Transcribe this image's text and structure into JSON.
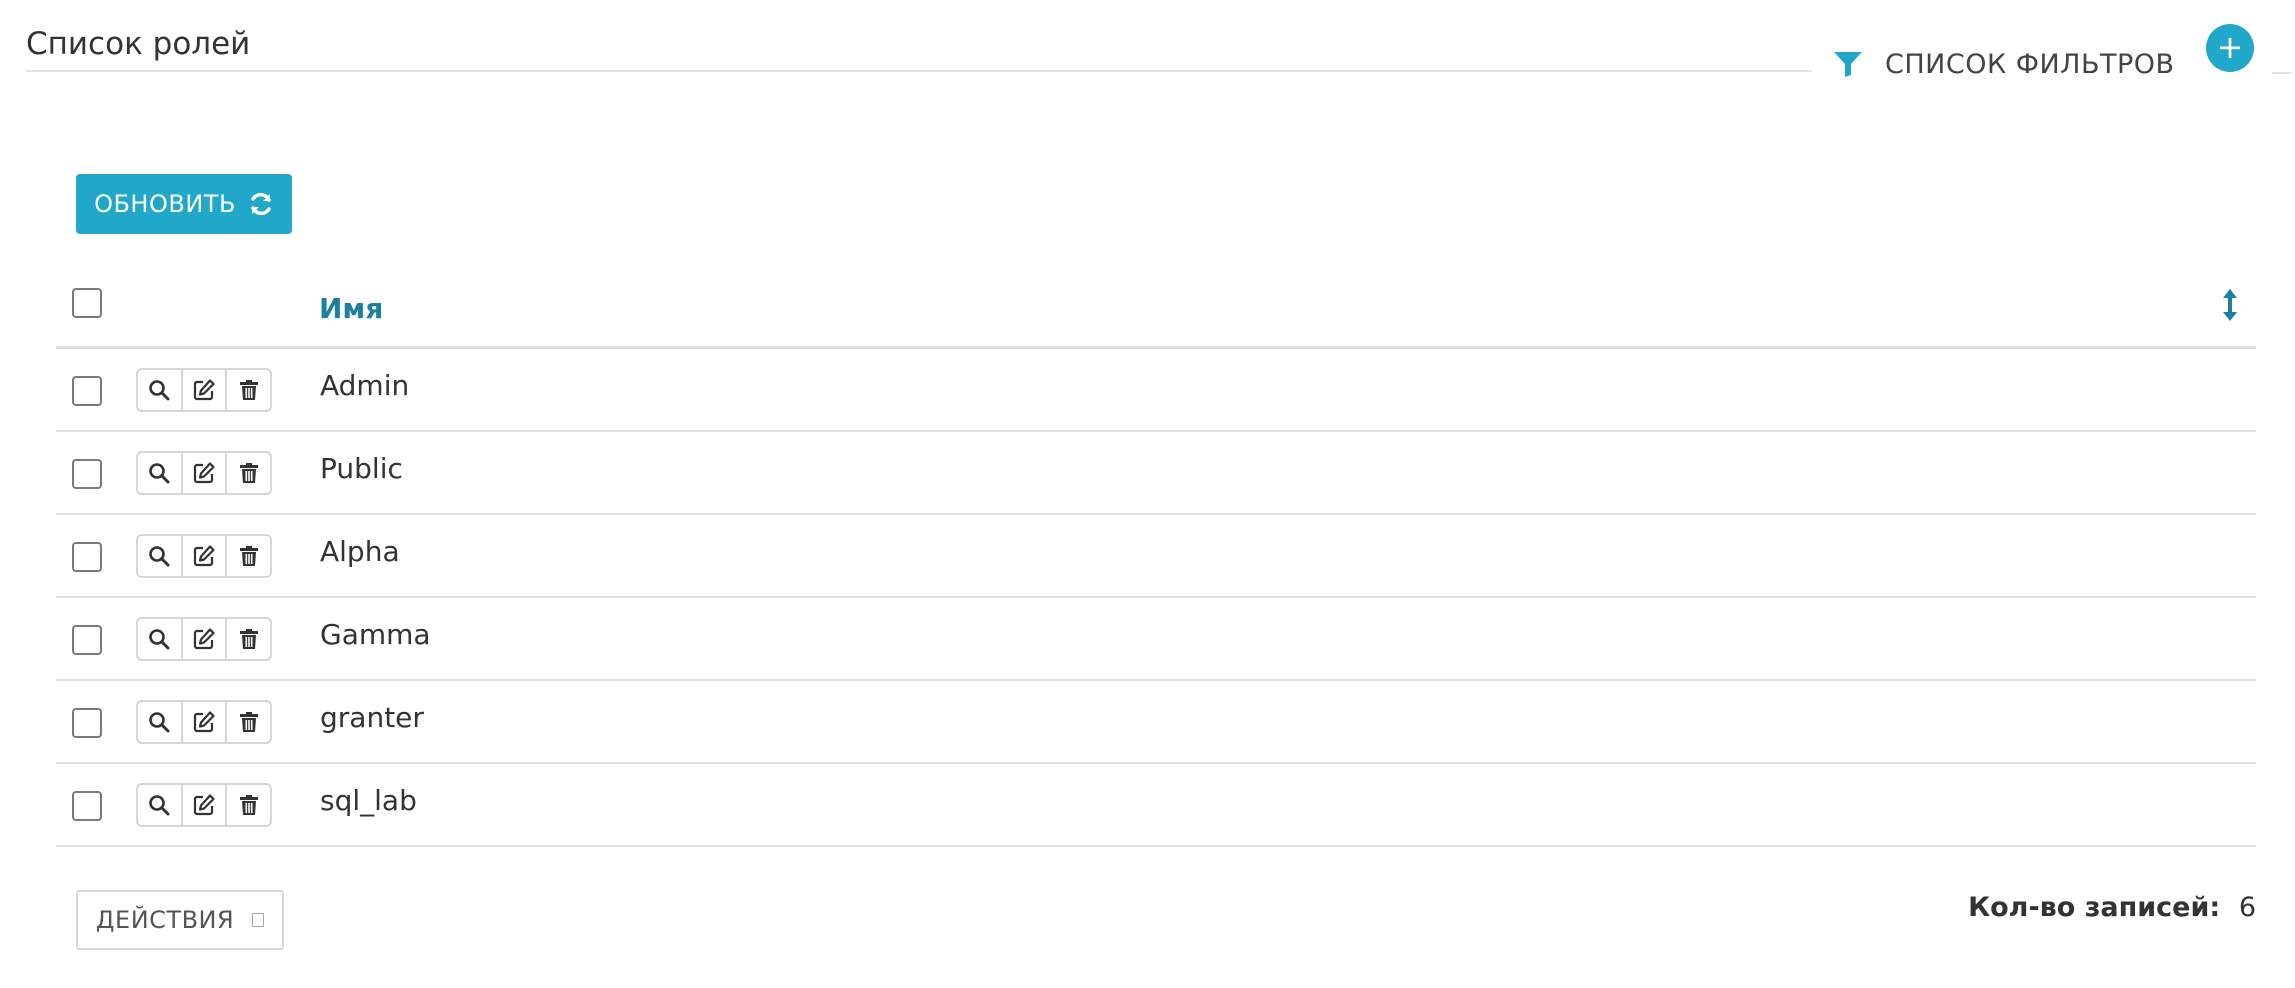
{
  "header": {
    "title": "Список ролей",
    "filter_label": "СПИСОК ФИЛЬТРОВ",
    "add_label": "+"
  },
  "toolbar": {
    "refresh_label": "ОБНОВИТЬ"
  },
  "table": {
    "columns": [
      "Имя"
    ],
    "rows": [
      {
        "name": "Admin"
      },
      {
        "name": "Public"
      },
      {
        "name": "Alpha"
      },
      {
        "name": "Gamma"
      },
      {
        "name": "granter"
      },
      {
        "name": "sql_lab"
      }
    ]
  },
  "footer": {
    "actions_label": "ДЕЙСТВИЯ",
    "record_count_label": "Кол-во записей:",
    "record_count_value": "6"
  },
  "icons": {
    "filter": "filter-icon",
    "add": "plus-icon",
    "refresh": "refresh-icon",
    "sort": "sort-icon",
    "view": "search-icon",
    "edit": "edit-icon",
    "delete": "trash-icon"
  },
  "colors": {
    "accent": "#20a7c9",
    "header_link": "#1c7fa3",
    "text": "#333333",
    "border": "#d6d6d6"
  }
}
